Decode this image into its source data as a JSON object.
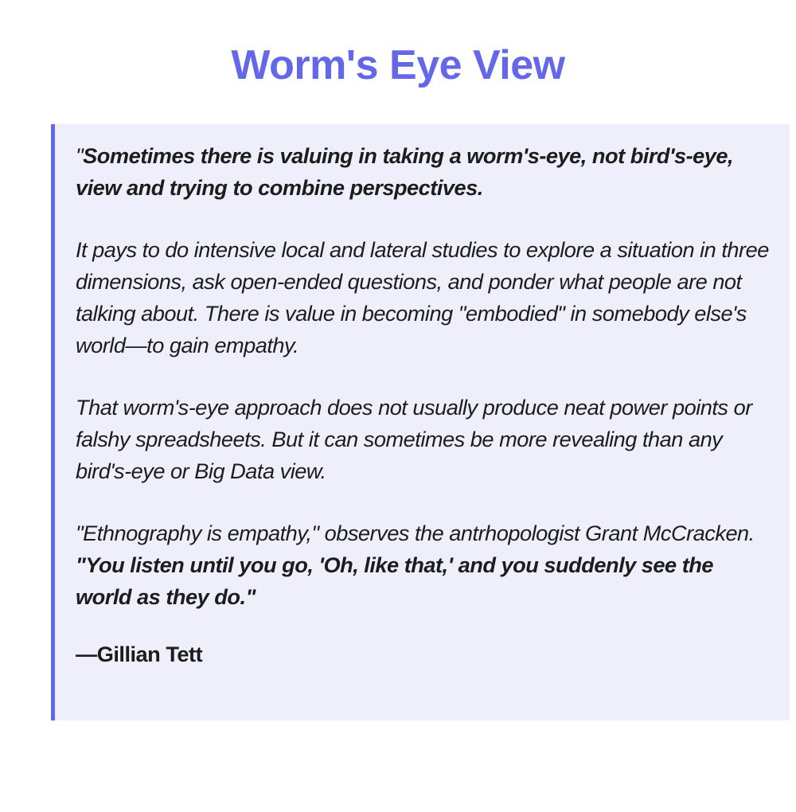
{
  "title": "Worm's Eye View",
  "colors": {
    "accent": "#6468e8",
    "panel_background": "#eeeffb",
    "text": "#1c1c1c"
  },
  "quote": {
    "p1_mark": "\"",
    "p1_bold": "Sometimes there is valuing in taking a worm's-eye, not bird's-eye, view and trying to combine perspectives.",
    "p2": "It pays to do intensive local and lateral studies to explore a situation in three dimensions, ask open-ended questions, and ponder what people are not talking about. There is value in becoming \"embodied\" in somebody else's world—to gain empathy.",
    "p3": "That worm's-eye approach does not usually produce neat power points or falshy spreadsheets. But it can sometimes be more revealing than any bird's-eye or Big Data view.",
    "p4_plain": "\"Ethnography is empathy,\" observes the antrhopologist Grant McCracken. ",
    "p4_bold": "\"You listen until you go, 'Oh, like that,' and you suddenly see the world as they do.\"",
    "attribution_dash": "—",
    "attribution_name": "Gillian Tett"
  }
}
